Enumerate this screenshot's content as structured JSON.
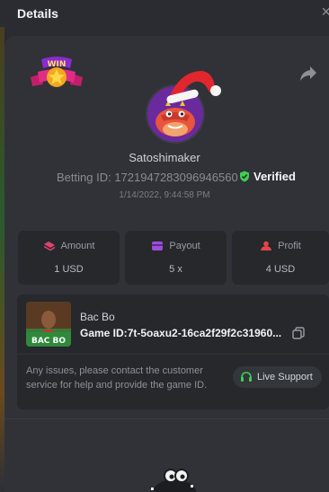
{
  "header": {
    "title": "Details",
    "close_glyph": "×"
  },
  "profile": {
    "username": "Satoshimaker",
    "betting_label": "Betting ID:",
    "betting_id": "1721947283096946560",
    "verified_label": "Verified",
    "timestamp": "1/14/2022, 9:44:58 PM",
    "badge_text": "WIN"
  },
  "stats": [
    {
      "label": "Amount",
      "value": "1 USD",
      "icon": "amount-icon"
    },
    {
      "label": "Payout",
      "value": "5 x",
      "icon": "payout-icon"
    },
    {
      "label": "Profit",
      "value": "4 USD",
      "icon": "profit-icon"
    }
  ],
  "game": {
    "name": "Bac Bo",
    "thumb_text": "BAC BO",
    "id_label": "Game ID:",
    "id_value": "7t-5oaxu2-16ca2f29f2c31960...",
    "issues_text": "Any issues, please contact the customer service for help and provide the game ID.",
    "support_label": "Live Support"
  },
  "colors": {
    "accent_green": "#3fcf56",
    "amount_pink": "#e0446e",
    "payout_purple": "#9d4ed8",
    "profit_red": "#e2464b",
    "panel": "#303237",
    "card": "#26282c"
  }
}
